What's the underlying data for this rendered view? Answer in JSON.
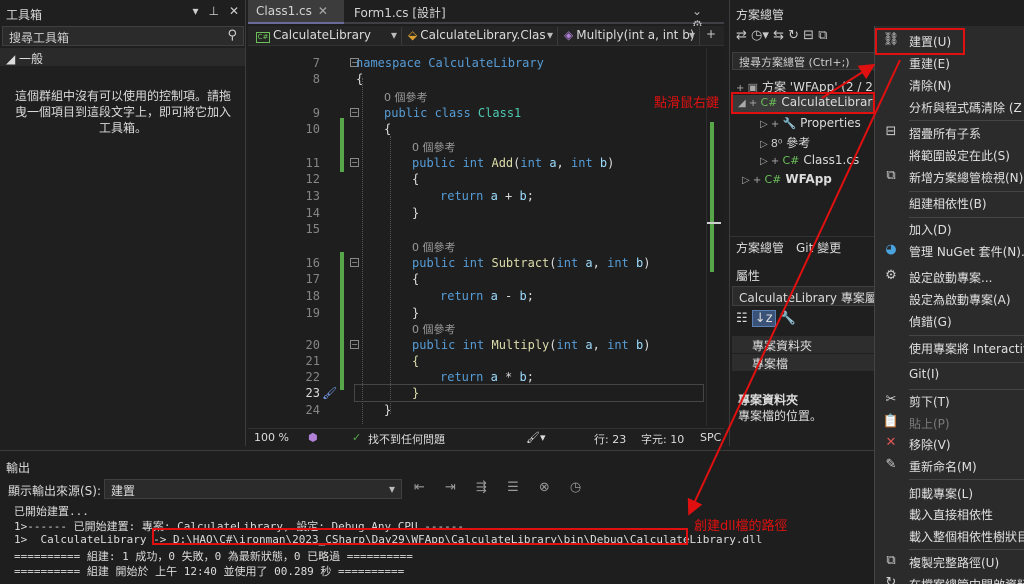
{
  "toolbox": {
    "title": "工具箱",
    "title_icons": [
      "▾",
      "⊥",
      "✕"
    ],
    "search_placeholder": "搜尋工具箱",
    "group": "◢ 一般",
    "empty_text": "這個群組中沒有可以使用的控制項。請拖曳一個項目到這段文字上，即可將它加入工具箱。"
  },
  "editor": {
    "tabs": [
      {
        "label": "Class1.cs",
        "active": true
      },
      {
        "label": "Form1.cs [設計]",
        "active": false
      }
    ],
    "tab_controls": "⌄ ⚙",
    "nav": {
      "project": "CalculateLibrary",
      "class": "CalculateLibrary.Clas",
      "member": "Multiply(int a, int b)"
    },
    "lines": [
      {
        "n": "7",
        "t": "namespace CalculateLibrary"
      },
      {
        "n": "8",
        "t": "{"
      },
      {
        "n": "",
        "t": "0 個參考"
      },
      {
        "n": "9",
        "t": "public class Class1"
      },
      {
        "n": "10",
        "t": "{"
      },
      {
        "n": "",
        "t": "0 個參考"
      },
      {
        "n": "11",
        "t": "public int Add(int a, int b)"
      },
      {
        "n": "12",
        "t": "{"
      },
      {
        "n": "13",
        "t": "return a + b;"
      },
      {
        "n": "14",
        "t": "}"
      },
      {
        "n": "15",
        "t": ""
      },
      {
        "n": "",
        "t": "0 個參考"
      },
      {
        "n": "16",
        "t": "public int Subtract(int a, int b)"
      },
      {
        "n": "17",
        "t": "{"
      },
      {
        "n": "18",
        "t": "return a - b;"
      },
      {
        "n": "19",
        "t": "}"
      },
      {
        "n": "",
        "t": "0 個參考"
      },
      {
        "n": "20",
        "t": "public int Multiply(int a, int b)"
      },
      {
        "n": "21",
        "t": "{"
      },
      {
        "n": "22",
        "t": "return a * b;"
      },
      {
        "n": "23",
        "t": "}"
      },
      {
        "n": "24",
        "t": "}"
      }
    ],
    "status": {
      "zoom": "100 %",
      "issues": "找不到任何問題",
      "line": "行: 23",
      "col": "字元: 10",
      "mode": "SPC"
    }
  },
  "solution_explorer": {
    "title": "方案總管",
    "search_placeholder": "搜尋方案總管 (Ctrl+;)",
    "items": [
      {
        "label": "方案 'WFApp' (2 / 2",
        "icon": "▣"
      },
      {
        "label": "CalculateLibrary",
        "icon": "C#",
        "selected": true
      },
      {
        "label": "Properties",
        "icon": "🔧"
      },
      {
        "label": "參考",
        "icon": "8⁰"
      },
      {
        "label": "Class1.cs",
        "icon": "C#"
      },
      {
        "label": "WFApp",
        "icon": "C#"
      }
    ],
    "bottom_tabs": [
      "方案總管",
      "Git 變更"
    ],
    "properties": {
      "title": "屬性",
      "object": "CalculateLibrary 專案屬",
      "rows": [
        "專案資料夾",
        "專案檔"
      ],
      "desc_title": "專案資料夾",
      "desc": "專案檔的位置。"
    }
  },
  "context_menu": {
    "items": [
      {
        "label": "建置(U)",
        "icon": "⛓"
      },
      {
        "label": "重建(E)",
        "icon": ""
      },
      {
        "label": "清除(N)",
        "icon": ""
      },
      {
        "label": "分析與程式碼清除 (Z",
        "icon": ""
      },
      {
        "label": "摺疊所有子系",
        "icon": "⊟"
      },
      {
        "label": "將範圍設定在此(S)",
        "icon": ""
      },
      {
        "label": "新增方案總管檢視(N)",
        "icon": "⧉"
      },
      {
        "label": "組建相依性(B)",
        "icon": ""
      },
      {
        "label": "加入(D)",
        "icon": ""
      },
      {
        "label": "管理 NuGet 套件(N)...",
        "icon": "◕"
      },
      {
        "label": "設定啟動專案...",
        "icon": "⚙"
      },
      {
        "label": "設定為啟動專案(A)",
        "icon": ""
      },
      {
        "label": "偵錯(G)",
        "icon": ""
      },
      {
        "label": "使用專案將 Interactive",
        "icon": ""
      },
      {
        "label": "Git(I)",
        "icon": ""
      },
      {
        "label": "剪下(T)",
        "icon": "✂"
      },
      {
        "label": "貼上(P)",
        "icon": "📋",
        "dim": true
      },
      {
        "label": "移除(V)",
        "icon": "✕"
      },
      {
        "label": "重新命名(M)",
        "icon": "✎"
      },
      {
        "label": "卸載專案(L)",
        "icon": ""
      },
      {
        "label": "載入直接相依性",
        "icon": ""
      },
      {
        "label": "載入整個相依性樹狀目",
        "icon": ""
      },
      {
        "label": "複製完整路徑(U)",
        "icon": "⧉"
      },
      {
        "label": "在檔案總管中開啟資料",
        "icon": "↻"
      }
    ]
  },
  "output": {
    "title": "輸出",
    "source_label": "顯示輸出來源(S):",
    "source_value": "建置",
    "tools": "⇤ ⇥ ⇶ ☰ ⊗ ◷",
    "lines": [
      "已開始建置...",
      "1>------ 已開始建置: 專案: CalculateLibrary, 設定: Debug Any CPU ------",
      "1>  CalculateLibrary -> D:\\HAO\\C#\\ironman\\2023_CSharp\\Day29\\WFApp\\CalculateLibrary\\bin\\Debug\\CalculateLibrary.dll",
      "========== 組建: 1 成功，0 失敗，0 為最新狀態，0 已略過 ==========",
      "========== 組建 開始於 上午 12:40 並使用了 00.289 秒 =========="
    ]
  },
  "annotations": {
    "right_click": "點滑鼠右鍵",
    "dll_path": "創建dll檔的路徑",
    "color": "#e01010"
  }
}
